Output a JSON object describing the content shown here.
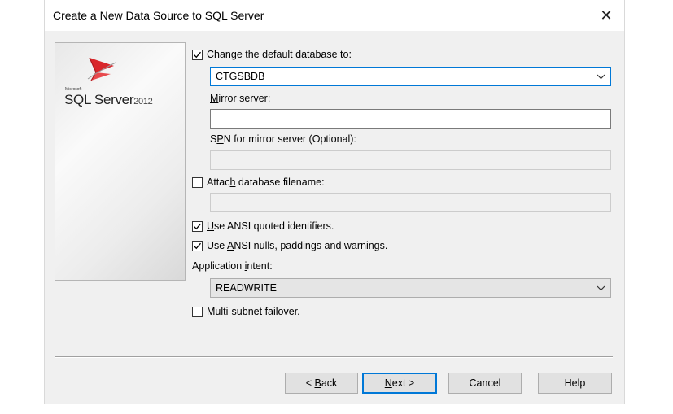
{
  "dialog": {
    "title": "Create a New Data Source to SQL Server",
    "close_label": "✕"
  },
  "brand": {
    "vendor": "Microsoft",
    "product": "SQL Server",
    "version": "2012"
  },
  "options": {
    "change_db": {
      "pre": "Change the ",
      "accel": "d",
      "post": "efault database to:",
      "checked": true
    },
    "database_value": "CTGSBDB",
    "mirror": {
      "accel": "M",
      "post": "irror server:",
      "value": ""
    },
    "spn": {
      "pre": "S",
      "accel": "P",
      "post": "N for mirror server (Optional):",
      "value": ""
    },
    "attach": {
      "pre": "Attac",
      "accel": "h",
      "post": " database filename:",
      "checked": false,
      "value": ""
    },
    "ansi_quoted": {
      "accel": "U",
      "post": "se ANSI quoted identifiers.",
      "checked": true
    },
    "ansi_nulls": {
      "pre": "Use ",
      "accel": "A",
      "post": "NSI nulls, paddings and warnings.",
      "checked": true
    },
    "app_intent": {
      "pre": "Application ",
      "accel": "i",
      "post": "ntent:",
      "value": "READWRITE"
    },
    "multisubnet": {
      "pre": "Multi-subnet ",
      "accel": "f",
      "post": "ailover.",
      "checked": false
    }
  },
  "buttons": {
    "back": {
      "pre": "< ",
      "accel": "B",
      "post": "ack"
    },
    "next": {
      "accel": "N",
      "post": "ext >"
    },
    "cancel": "Cancel",
    "help": "Help"
  },
  "icons": {
    "checkbox_checked": "checkmark-icon",
    "dropdown": "chevron-down-icon",
    "close": "close-icon"
  },
  "colors": {
    "accent": "#0078d7",
    "dialog_bg": "#f0f0f0"
  }
}
